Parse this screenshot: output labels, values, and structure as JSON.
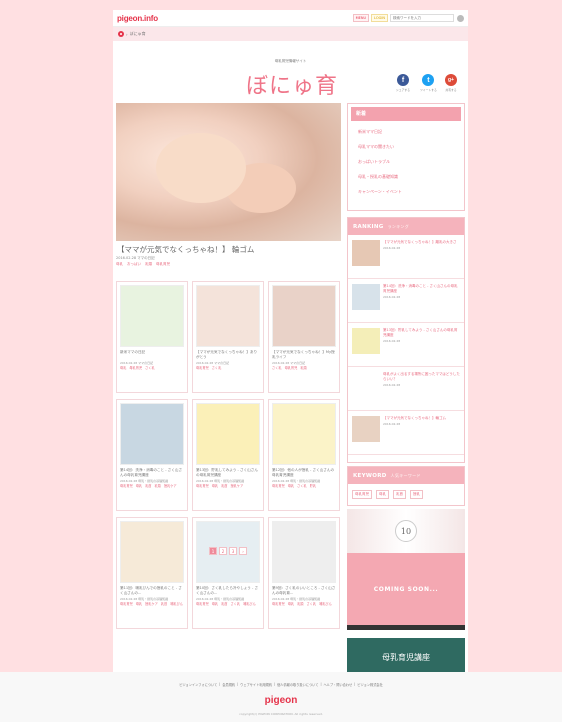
{
  "header": {
    "logo": "pigeon.info",
    "menu_label": "MENU",
    "login_label": "LOGIN",
    "search_placeholder": "検索ワードを入力"
  },
  "breadcrumb": {
    "current": "ぼにゅ育"
  },
  "hero": {
    "subtitle": "母乳育児情報サイト",
    "title": "ぼにゅ育",
    "social": [
      {
        "icon": "facebook-icon",
        "glyph": "f",
        "label": "シェアする",
        "color": "#3b5998"
      },
      {
        "icon": "twitter-icon",
        "glyph": "t",
        "label": "ツイートする",
        "color": "#1da1f2"
      },
      {
        "icon": "google-plus-icon",
        "glyph": "g+",
        "label": "共有する",
        "color": "#dd4b39"
      }
    ]
  },
  "featured": {
    "title": "【ママが元気でなくっちゃね！】 輪ゴム",
    "date": "2016.02.28",
    "category": "ママの日記",
    "tags": [
      "母乳",
      "おっぱい",
      "乳頭",
      "母乳育児"
    ]
  },
  "cards": [
    {
      "title": "新米ママの日記",
      "date": "2016.02.28",
      "category": "ママの日記",
      "tags": [
        "母乳",
        "母乳育児",
        "さく乳"
      ],
      "bg": "#e8f3e0"
    },
    {
      "title": "【ママが元気でなくっちゃね！】ありがとう",
      "date": "2016.02.28",
      "category": "ママの日記",
      "tags": [
        "母乳育児",
        "さく乳"
      ],
      "bg": "#f4e3da"
    },
    {
      "title": "【ママが元気でなくっちゃね！】My授乳ライフ",
      "date": "2016.02.28",
      "category": "ママの日記",
      "tags": [
        "さく乳",
        "母乳育児",
        "乳頭"
      ],
      "bg": "#e9d2c8"
    },
    {
      "title": "第14回：洗浄・消毒のこと - さく山さんの母乳育児講座",
      "date": "2016.02.28",
      "category": "母乳・授乳の基礎知識",
      "tags": [
        "母乳育児",
        "母乳",
        "乳首",
        "乳頭",
        "授乳ケア"
      ],
      "bg": "#c8d7e2"
    },
    {
      "title": "第13回：貯乳してみよう - さく山さんの母乳育児講座",
      "date": "2016.02.28",
      "category": "母乳・授乳の基礎知識",
      "tags": [
        "母乳育児",
        "母乳",
        "乳首",
        "授乳ケア"
      ],
      "bg": "#fbf0b8"
    },
    {
      "title": "第12回：他の人が授乳 - さく山さんの母乳育児講座",
      "date": "2016.02.28",
      "category": "母乳・授乳の基礎知識",
      "tags": [
        "母乳育児",
        "母乳",
        "さく乳",
        "貯乳"
      ],
      "bg": "#fbf3c8"
    },
    {
      "title": "第11回：哺乳びんでの授乳のこと - さく山さんの...",
      "date": "2016.02.28",
      "category": "母乳・授乳の基礎知識",
      "tags": [
        "母乳育児",
        "母乳",
        "授乳ケア",
        "乳首",
        "哺乳びん"
      ],
      "bg": "#f6ead8"
    },
    {
      "title": "第10回：さく乳したら冷やしょう - さく山さんの...",
      "date": "2016.02.28",
      "category": "母乳・授乳の基礎知識",
      "tags": [
        "母乳育児",
        "母乳",
        "乳首",
        "さく乳",
        "哺乳びん"
      ],
      "bg": "#e6eef2"
    },
    {
      "title": "第9回：さく乳のいいところ - さく山さんの母乳育...",
      "date": "2016.02.28",
      "category": "母乳・授乳の基礎知識",
      "tags": [
        "母乳育児",
        "母乳",
        "乳頭",
        "さく乳",
        "哺乳びん"
      ],
      "bg": "#eeeeee"
    }
  ],
  "pagination": [
    "1",
    "2",
    "3",
    "›"
  ],
  "sidebar": {
    "new_label": "新着",
    "links": [
      "新米ママ日記",
      "母乳ママの聞きたい",
      "おっぱいトラブル",
      "母乳・授乳の基礎知識",
      "キャンペーン・イベント"
    ],
    "ranking_label": "RANKING",
    "ranking_sub": "ランキング",
    "ranking": [
      {
        "title": "【ママが元気でなくっちゃね！】離乳の大きさ",
        "date": "2016.02.28"
      },
      {
        "title": "第14回：洗浄・消毒のこと - さく山さんの母乳育児講座",
        "date": "2016.02.28"
      },
      {
        "title": "第13回：貯乳してみよう - さく山さんの母乳育児講座",
        "date": "2016.02.28"
      },
      {
        "title": "母乳がよく出るする場所に困ったママはどうしたらいい？",
        "date": "2016.02.28"
      },
      {
        "title": "【ママが元気でなくっちゃね！】輪ゴム",
        "date": "2016.02.28"
      }
    ],
    "keyword_label": "KEYWORD",
    "keyword_sub": "人気キーワード",
    "keywords": [
      "母乳育児",
      "母乳",
      "乳首",
      "授乳"
    ],
    "banner_badge": "10",
    "coming_soon": "COMING SOON...",
    "course_label": "母乳育児講座"
  },
  "footer": {
    "links": [
      "ピジョンインフォについて",
      "会員規約",
      "ウェブサイト利用規約",
      "個人情報の取り扱いについて",
      "ヘルプ・問い合わせ",
      "ピジョン株式会社"
    ],
    "logo": "pigeon",
    "copyright": "copyright(c) PIGEON CORPORATION. All rights reserved."
  }
}
